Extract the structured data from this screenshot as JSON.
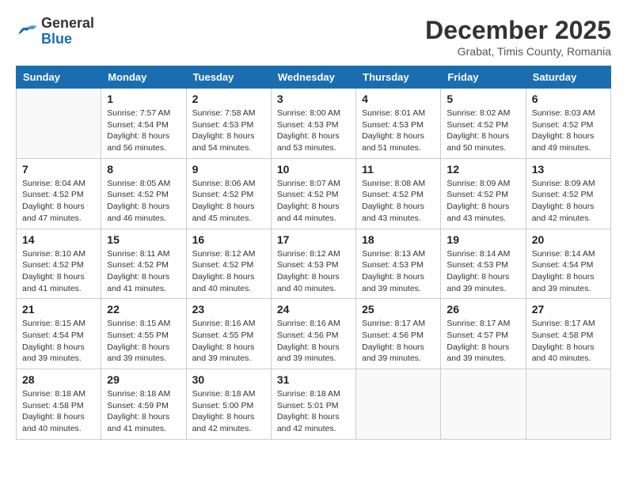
{
  "header": {
    "logo_line1": "General",
    "logo_line2": "Blue",
    "month_year": "December 2025",
    "location": "Grabat, Timis County, Romania"
  },
  "days_of_week": [
    "Sunday",
    "Monday",
    "Tuesday",
    "Wednesday",
    "Thursday",
    "Friday",
    "Saturday"
  ],
  "weeks": [
    [
      {
        "day": "",
        "info": ""
      },
      {
        "day": "1",
        "info": "Sunrise: 7:57 AM\nSunset: 4:54 PM\nDaylight: 8 hours\nand 56 minutes."
      },
      {
        "day": "2",
        "info": "Sunrise: 7:58 AM\nSunset: 4:53 PM\nDaylight: 8 hours\nand 54 minutes."
      },
      {
        "day": "3",
        "info": "Sunrise: 8:00 AM\nSunset: 4:53 PM\nDaylight: 8 hours\nand 53 minutes."
      },
      {
        "day": "4",
        "info": "Sunrise: 8:01 AM\nSunset: 4:53 PM\nDaylight: 8 hours\nand 51 minutes."
      },
      {
        "day": "5",
        "info": "Sunrise: 8:02 AM\nSunset: 4:52 PM\nDaylight: 8 hours\nand 50 minutes."
      },
      {
        "day": "6",
        "info": "Sunrise: 8:03 AM\nSunset: 4:52 PM\nDaylight: 8 hours\nand 49 minutes."
      }
    ],
    [
      {
        "day": "7",
        "info": "Sunrise: 8:04 AM\nSunset: 4:52 PM\nDaylight: 8 hours\nand 47 minutes."
      },
      {
        "day": "8",
        "info": "Sunrise: 8:05 AM\nSunset: 4:52 PM\nDaylight: 8 hours\nand 46 minutes."
      },
      {
        "day": "9",
        "info": "Sunrise: 8:06 AM\nSunset: 4:52 PM\nDaylight: 8 hours\nand 45 minutes."
      },
      {
        "day": "10",
        "info": "Sunrise: 8:07 AM\nSunset: 4:52 PM\nDaylight: 8 hours\nand 44 minutes."
      },
      {
        "day": "11",
        "info": "Sunrise: 8:08 AM\nSunset: 4:52 PM\nDaylight: 8 hours\nand 43 minutes."
      },
      {
        "day": "12",
        "info": "Sunrise: 8:09 AM\nSunset: 4:52 PM\nDaylight: 8 hours\nand 43 minutes."
      },
      {
        "day": "13",
        "info": "Sunrise: 8:09 AM\nSunset: 4:52 PM\nDaylight: 8 hours\nand 42 minutes."
      }
    ],
    [
      {
        "day": "14",
        "info": "Sunrise: 8:10 AM\nSunset: 4:52 PM\nDaylight: 8 hours\nand 41 minutes."
      },
      {
        "day": "15",
        "info": "Sunrise: 8:11 AM\nSunset: 4:52 PM\nDaylight: 8 hours\nand 41 minutes."
      },
      {
        "day": "16",
        "info": "Sunrise: 8:12 AM\nSunset: 4:52 PM\nDaylight: 8 hours\nand 40 minutes."
      },
      {
        "day": "17",
        "info": "Sunrise: 8:12 AM\nSunset: 4:53 PM\nDaylight: 8 hours\nand 40 minutes."
      },
      {
        "day": "18",
        "info": "Sunrise: 8:13 AM\nSunset: 4:53 PM\nDaylight: 8 hours\nand 39 minutes."
      },
      {
        "day": "19",
        "info": "Sunrise: 8:14 AM\nSunset: 4:53 PM\nDaylight: 8 hours\nand 39 minutes."
      },
      {
        "day": "20",
        "info": "Sunrise: 8:14 AM\nSunset: 4:54 PM\nDaylight: 8 hours\nand 39 minutes."
      }
    ],
    [
      {
        "day": "21",
        "info": "Sunrise: 8:15 AM\nSunset: 4:54 PM\nDaylight: 8 hours\nand 39 minutes."
      },
      {
        "day": "22",
        "info": "Sunrise: 8:15 AM\nSunset: 4:55 PM\nDaylight: 8 hours\nand 39 minutes."
      },
      {
        "day": "23",
        "info": "Sunrise: 8:16 AM\nSunset: 4:55 PM\nDaylight: 8 hours\nand 39 minutes."
      },
      {
        "day": "24",
        "info": "Sunrise: 8:16 AM\nSunset: 4:56 PM\nDaylight: 8 hours\nand 39 minutes."
      },
      {
        "day": "25",
        "info": "Sunrise: 8:17 AM\nSunset: 4:56 PM\nDaylight: 8 hours\nand 39 minutes."
      },
      {
        "day": "26",
        "info": "Sunrise: 8:17 AM\nSunset: 4:57 PM\nDaylight: 8 hours\nand 39 minutes."
      },
      {
        "day": "27",
        "info": "Sunrise: 8:17 AM\nSunset: 4:58 PM\nDaylight: 8 hours\nand 40 minutes."
      }
    ],
    [
      {
        "day": "28",
        "info": "Sunrise: 8:18 AM\nSunset: 4:58 PM\nDaylight: 8 hours\nand 40 minutes."
      },
      {
        "day": "29",
        "info": "Sunrise: 8:18 AM\nSunset: 4:59 PM\nDaylight: 8 hours\nand 41 minutes."
      },
      {
        "day": "30",
        "info": "Sunrise: 8:18 AM\nSunset: 5:00 PM\nDaylight: 8 hours\nand 42 minutes."
      },
      {
        "day": "31",
        "info": "Sunrise: 8:18 AM\nSunset: 5:01 PM\nDaylight: 8 hours\nand 42 minutes."
      },
      {
        "day": "",
        "info": ""
      },
      {
        "day": "",
        "info": ""
      },
      {
        "day": "",
        "info": ""
      }
    ]
  ]
}
